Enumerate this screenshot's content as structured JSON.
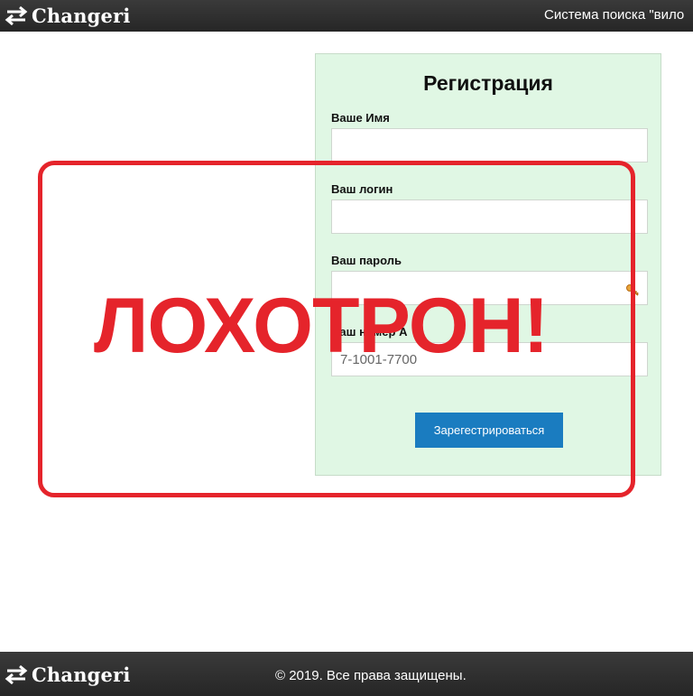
{
  "header": {
    "logo_text": "Changeri",
    "right_text": "Система поиска \"вило"
  },
  "form": {
    "title": "Регистрация",
    "fields": [
      {
        "label": "Ваше Имя",
        "value": ""
      },
      {
        "label": "Ваш логин",
        "value": ""
      },
      {
        "label": "Ваш пароль",
        "value": ""
      },
      {
        "label": "Ваш номер A",
        "value": "",
        "placeholder": "7-1001-7700"
      }
    ],
    "submit_label": "Зарегестрироваться"
  },
  "overlay": {
    "stamp_text": "ЛОХОТРОН!",
    "color": "#e5242b"
  },
  "footer": {
    "logo_text": "Changeri",
    "copyright": "© 2019. Все права защищены."
  },
  "colors": {
    "bar_bg": "#2e2e2e",
    "form_bg": "#e0f7e4",
    "button": "#1a7cc0"
  },
  "icons": {
    "logo": "swap-arrows-icon",
    "password_helper": "key-icon"
  }
}
